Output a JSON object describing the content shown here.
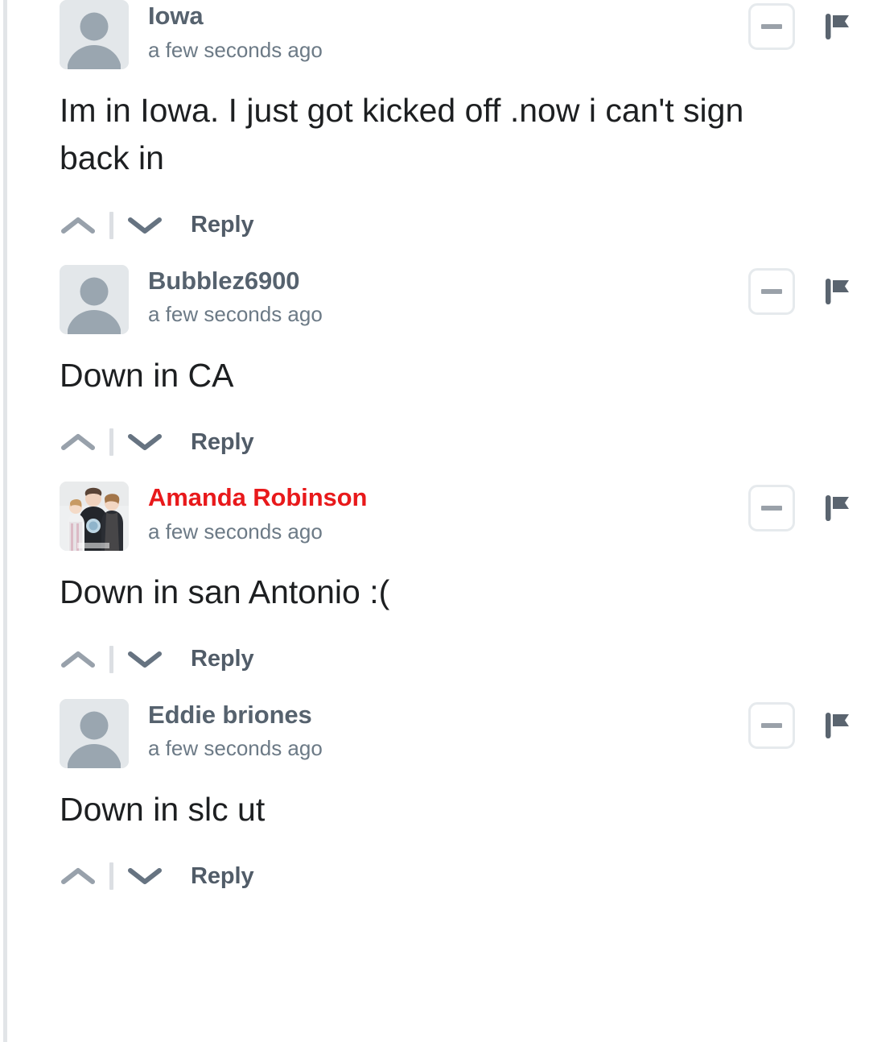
{
  "thread": {
    "comments": [
      {
        "id": "comment-iowa",
        "author": "Iowa",
        "is_author_highlighted": false,
        "timestamp": "a few seconds ago",
        "avatar_type": "placeholder-person-icon",
        "body": "Im in Iowa. I just got kicked off .now i can't sign back in",
        "collapse_label": "–",
        "reply_label": "Reply"
      },
      {
        "id": "comment-bubblez6900",
        "author": "Bubblez6900",
        "is_author_highlighted": false,
        "timestamp": "a few seconds ago",
        "avatar_type": "placeholder-person-icon",
        "body": "Down in CA",
        "collapse_label": "–",
        "reply_label": "Reply"
      },
      {
        "id": "comment-amanda-robinson",
        "author": "Amanda Robinson",
        "is_author_highlighted": true,
        "timestamp": "a few seconds ago",
        "avatar_type": "photo-family",
        "body": "Down in san Antonio :(",
        "collapse_label": "–",
        "reply_label": "Reply"
      },
      {
        "id": "comment-eddie-briones",
        "author": "Eddie briones",
        "is_author_highlighted": false,
        "timestamp": "a few seconds ago",
        "avatar_type": "placeholder-person-icon",
        "body": "Down in slc ut",
        "collapse_label": "–",
        "reply_label": "Reply"
      }
    ]
  },
  "icons": {
    "collapse": "minus-icon",
    "report": "flag-icon",
    "upvote": "chevron-up-icon",
    "downvote": "chevron-down-icon",
    "avatar_placeholder": "person-icon"
  },
  "colors": {
    "username": "#56626e",
    "username_highlighted": "#e8191b",
    "timestamp": "#6c7a86",
    "body_text": "#1d1f21",
    "reply_link": "#515c68",
    "icon_gray": "#67717c",
    "chevron_gray": "#9aa3ad",
    "border_light": "#e6eaed",
    "avatar_placeholder_bg": "#e3e7ea",
    "thread_line": "#e2e5e8",
    "background": "#ffffff"
  }
}
